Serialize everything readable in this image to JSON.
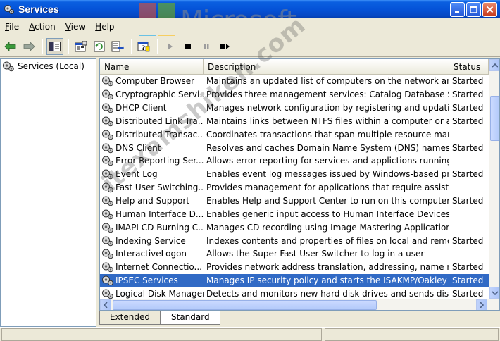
{
  "window": {
    "title": "Services",
    "buttons": {
      "minimize": "_",
      "maximize": "□",
      "close": "✕"
    }
  },
  "watermark": {
    "logo_text": "Microsoft",
    "logo_colors": [
      "#f25022",
      "#7fba00",
      "#00a4ef",
      "#ffb900"
    ],
    "diagonal_text": "itexamshiken.com"
  },
  "menu": {
    "items": [
      {
        "key": "F",
        "rest": "ile"
      },
      {
        "key": "A",
        "rest": "ction"
      },
      {
        "key": "V",
        "rest": "iew"
      },
      {
        "key": "H",
        "rest": "elp"
      }
    ]
  },
  "toolbar": {
    "icons": [
      "back-arrow-icon",
      "forward-arrow-icon",
      "show-hide-tree-icon",
      "properties-icon",
      "refresh-icon",
      "export-list-icon",
      "help-icon",
      "start-service-icon",
      "stop-service-icon",
      "pause-service-icon",
      "restart-service-icon"
    ]
  },
  "tree": {
    "root_label": "Services (Local)"
  },
  "list": {
    "columns": {
      "name": "Name",
      "description": "Description",
      "status": "Status"
    },
    "rows": [
      {
        "name": "Computer Browser",
        "description": "Maintains an updated list of computers on the network and...",
        "status": "Started"
      },
      {
        "name": "Cryptographic Servi...",
        "description": "Provides three management services: Catalog Database S...",
        "status": "Started"
      },
      {
        "name": "DHCP Client",
        "description": "Manages network configuration by registering and updatin...",
        "status": "Started"
      },
      {
        "name": "Distributed Link Tra...",
        "description": "Maintains links between NTFS files within a computer or acr...",
        "status": "Started"
      },
      {
        "name": "Distributed Transac...",
        "description": "Coordinates transactions that span multiple resource mana...",
        "status": ""
      },
      {
        "name": "DNS Client",
        "description": "Resolves and caches Domain Name System (DNS) names f...",
        "status": "Started"
      },
      {
        "name": "Error Reporting Ser...",
        "description": "Allows error reporting for services and applictions running i...",
        "status": ""
      },
      {
        "name": "Event Log",
        "description": "Enables event log messages issued by Windows-based pro...",
        "status": "Started"
      },
      {
        "name": "Fast User Switching...",
        "description": "Provides management for applications that require assista...",
        "status": ""
      },
      {
        "name": "Help and Support",
        "description": "Enables Help and Support Center to run on this computer. ...",
        "status": "Started"
      },
      {
        "name": "Human Interface D...",
        "description": "Enables generic input access to Human Interface Devices (...",
        "status": ""
      },
      {
        "name": "IMAPI CD-Burning C...",
        "description": "Manages CD recording using Image Mastering Applications ...",
        "status": ""
      },
      {
        "name": "Indexing Service",
        "description": "Indexes contents and properties of files on local and remot...",
        "status": "Started"
      },
      {
        "name": "InteractiveLogon",
        "description": "Allows the Super-Fast User Switcher to log in a user",
        "status": ""
      },
      {
        "name": "Internet Connectio...",
        "description": "Provides network address translation, addressing, name re...",
        "status": "Started"
      },
      {
        "name": "IPSEC Services",
        "description": "Manages IP security policy and starts the ISAKMP/Oakley (...",
        "status": "Started"
      },
      {
        "name": "Logical Disk Manager",
        "description": "Detects and monitors new hard disk drives and sends disk ...",
        "status": "Started"
      }
    ],
    "selected_index": 15
  },
  "tabs": {
    "extended": "Extended",
    "standard": "Standard",
    "active": "standard"
  }
}
